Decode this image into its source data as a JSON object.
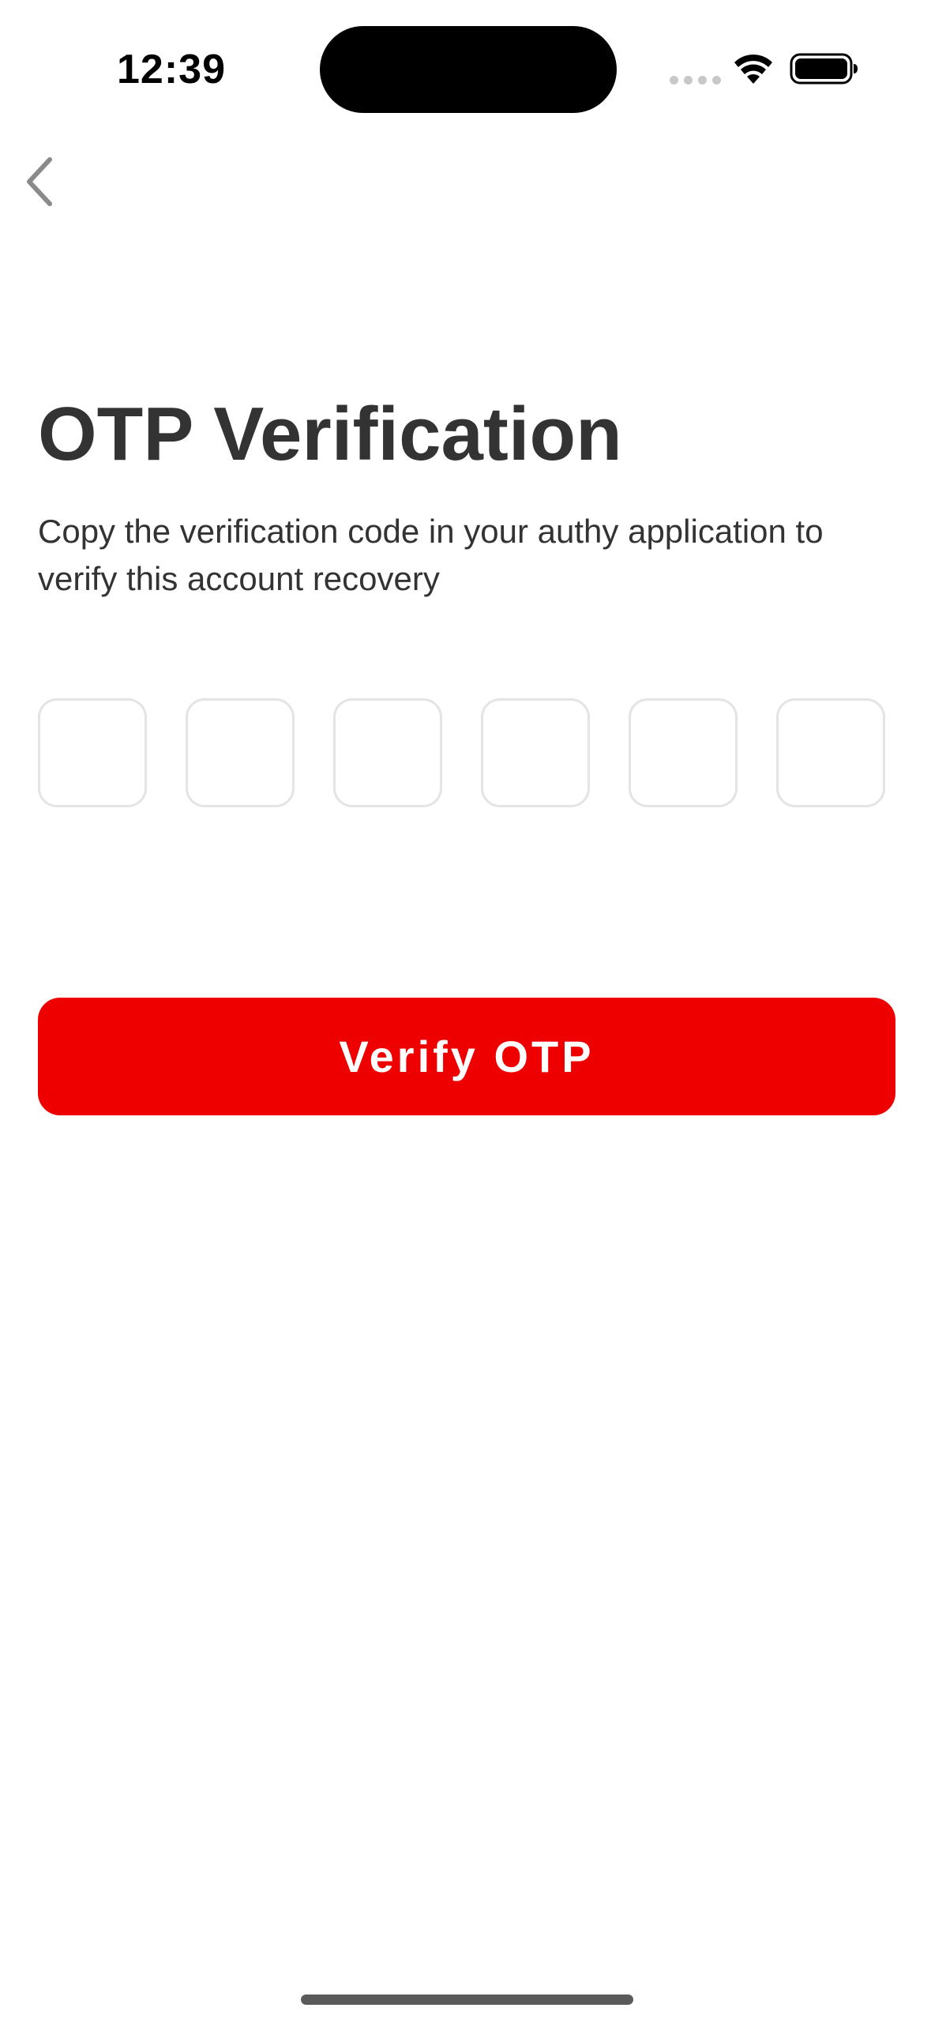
{
  "status_bar": {
    "time": "12:39"
  },
  "header": {
    "back_icon": "chevron-left-icon"
  },
  "main": {
    "title": "OTP Verification",
    "subtitle": "Copy the verification code in your authy application to verify this account recovery",
    "otp_digits": [
      "",
      "",
      "",
      "",
      "",
      ""
    ],
    "verify_label": "Verify OTP"
  },
  "colors": {
    "accent": "#ee0000",
    "text": "#333333",
    "input_border": "#e4e4e4",
    "background": "#ffffff"
  }
}
